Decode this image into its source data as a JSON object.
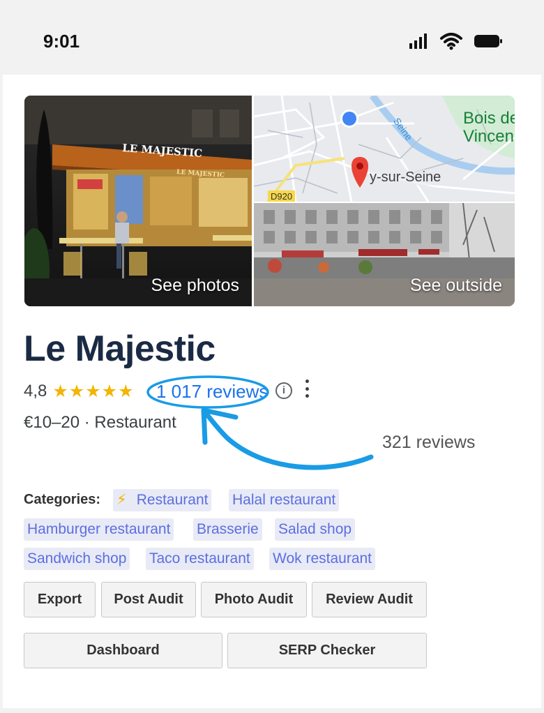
{
  "status_bar": {
    "time": "9:01",
    "icons": [
      "signal-icon",
      "wifi-icon",
      "battery-icon"
    ]
  },
  "media": {
    "main_photo": {
      "storefront_sign": "LE MAJESTIC",
      "caption": "See photos"
    },
    "map": {
      "label_bois": "Bois de Vincennes",
      "label_bois_line1": "Bois de",
      "label_bois_line2": "Vincenn",
      "label_city": "y-sur-Seine",
      "label_river": "Seine",
      "road": "D920"
    },
    "street_photo": {
      "caption": "See outside"
    }
  },
  "place": {
    "name": "Le Majestic",
    "rating": "4,8",
    "stars": 5,
    "reviews_text": "1 017 reviews",
    "price_category": "€10–20 · Restaurant"
  },
  "annotation": {
    "text": "321 reviews",
    "color": "#1a9be6"
  },
  "categories": {
    "label": "Categories:",
    "items": [
      "Restaurant",
      "Halal restaurant",
      "Hamburger restaurant",
      "Brasserie",
      "Salad shop",
      "Sandwich shop",
      "Taco restaurant",
      "Wok restaurant"
    ]
  },
  "buttons": {
    "export": "Export",
    "post_audit": "Post Audit",
    "photo_audit": "Photo Audit",
    "review_audit": "Review Audit",
    "dashboard": "Dashboard",
    "serp_checker": "SERP Checker"
  },
  "colors": {
    "star": "#f4b400",
    "link": "#1a73e8",
    "chip_bg": "#e8eaf6",
    "chip_text": "#5b6fe0",
    "title": "#1b2a44"
  }
}
